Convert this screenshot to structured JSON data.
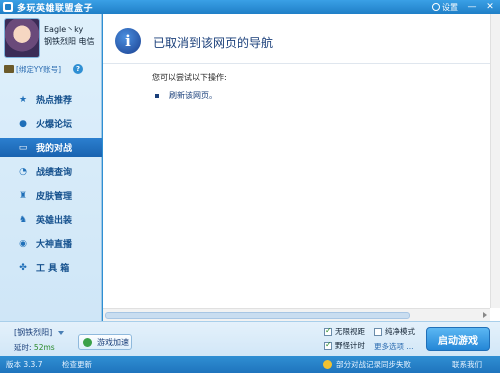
{
  "titlebar": {
    "title": "多玩英雄联盟盒子",
    "settings_label": "设置",
    "minimize": "—",
    "close": "✕"
  },
  "user": {
    "name": "Eagle丶ky",
    "server": "钢铁烈阳  电信",
    "bind_label": "[绑定YY账号]",
    "help": "?"
  },
  "nav": [
    {
      "label": "热点推荐",
      "icon": "star-icon",
      "glyph": "★"
    },
    {
      "label": "火爆论坛",
      "icon": "chat-bubble-icon",
      "glyph": "●"
    },
    {
      "label": "我的对战",
      "icon": "battle-icon",
      "glyph": "▭"
    },
    {
      "label": "战绩查询",
      "icon": "search-icon",
      "glyph": "◔"
    },
    {
      "label": "皮肤管理",
      "icon": "shirt-icon",
      "glyph": "♜"
    },
    {
      "label": "英雄出装",
      "icon": "helmet-icon",
      "glyph": "♞"
    },
    {
      "label": "大神直播",
      "icon": "live-icon",
      "glyph": "◉"
    },
    {
      "label": "工 具 箱",
      "icon": "tools-icon",
      "glyph": "✤"
    }
  ],
  "active_nav": "我的对战",
  "content": {
    "heading": "已取消到该网页的导航",
    "instruction": "您可以尝试以下操作:",
    "action_link": "刷新该网页。"
  },
  "bottombar": {
    "server": "[钢铁烈阳]",
    "latency_label": "延时:",
    "latency_value": "52ms",
    "accel_button": "游戏加速",
    "opt_unlimited_view": "无限视距",
    "opt_pure_mode": "纯净模式",
    "opt_timer": "野怪计时",
    "opt_more": "更多选项 ...",
    "start_button": "启动游戏"
  },
  "statusbar": {
    "version": "版本 3.3.7",
    "update": "检查更新",
    "warning": "部分对战记录同步失败",
    "contact": "联系我们"
  },
  "colors": {
    "accent": "#2f8fd3",
    "active_nav": "#1a63b0",
    "start_button": "#2486d6"
  }
}
